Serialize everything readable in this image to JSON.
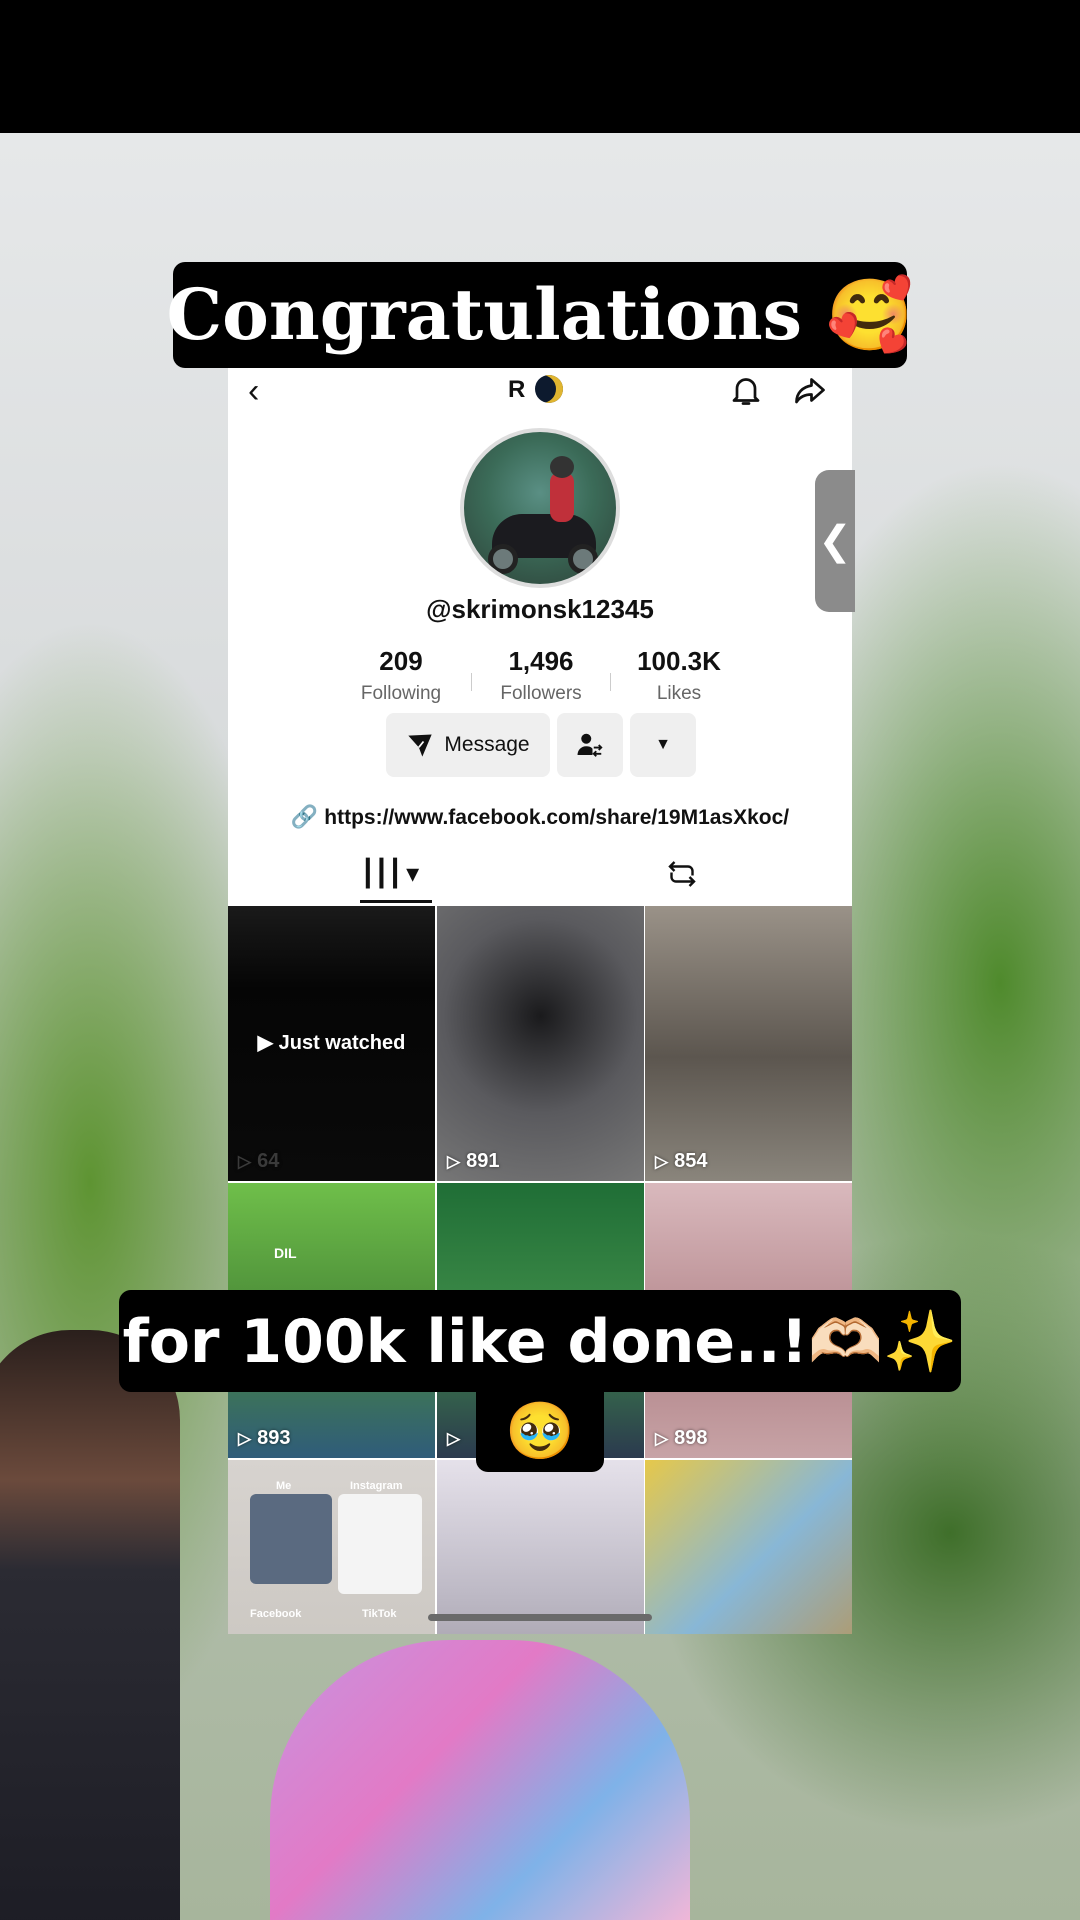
{
  "overlay": {
    "top_caption": "Congratulations 🥰",
    "bottom_caption": "for 100k like done..!🫶🏻✨",
    "bottom_emoji": "🥹"
  },
  "profile": {
    "nickname": "R",
    "username": "@skrimonsk12345",
    "stats": [
      {
        "value": "209",
        "label": "Following"
      },
      {
        "value": "1,496",
        "label": "Followers"
      },
      {
        "value": "100.3K",
        "label": "Likes"
      }
    ],
    "message_label": "Message",
    "more_label": "▼",
    "link": "https://www.facebook.com/share/19M1asXkoc/",
    "icons": {
      "back": "back-arrow-icon",
      "bell": "bell-icon",
      "share": "share-icon",
      "friend": "add-friend-icon",
      "link": "link-icon",
      "videos_tab": "videos-grid-icon",
      "repost_tab": "repost-icon"
    }
  },
  "grid": {
    "just_watched": "Just watched",
    "videos": [
      {
        "views": "64",
        "color": "#0a0a0a"
      },
      {
        "views": "891",
        "color": "#4a4a4d"
      },
      {
        "views": "854",
        "color": "#6f6a62"
      },
      {
        "views": "893",
        "color": "#6c8f4a"
      },
      {
        "views": "",
        "color": "#2f6b3c"
      },
      {
        "views": "898",
        "color": "#b89a9d"
      },
      {
        "views": "",
        "color": "#cfcfcf"
      },
      {
        "views": "",
        "color": "#bcb8c4"
      },
      {
        "views": "",
        "color": "#c9b84c"
      }
    ],
    "tile_texts": {
      "dil": "DIL",
      "me": "Me",
      "instagram": "Instagram",
      "facebook": "Facebook",
      "tiktok": "TikTok"
    }
  }
}
